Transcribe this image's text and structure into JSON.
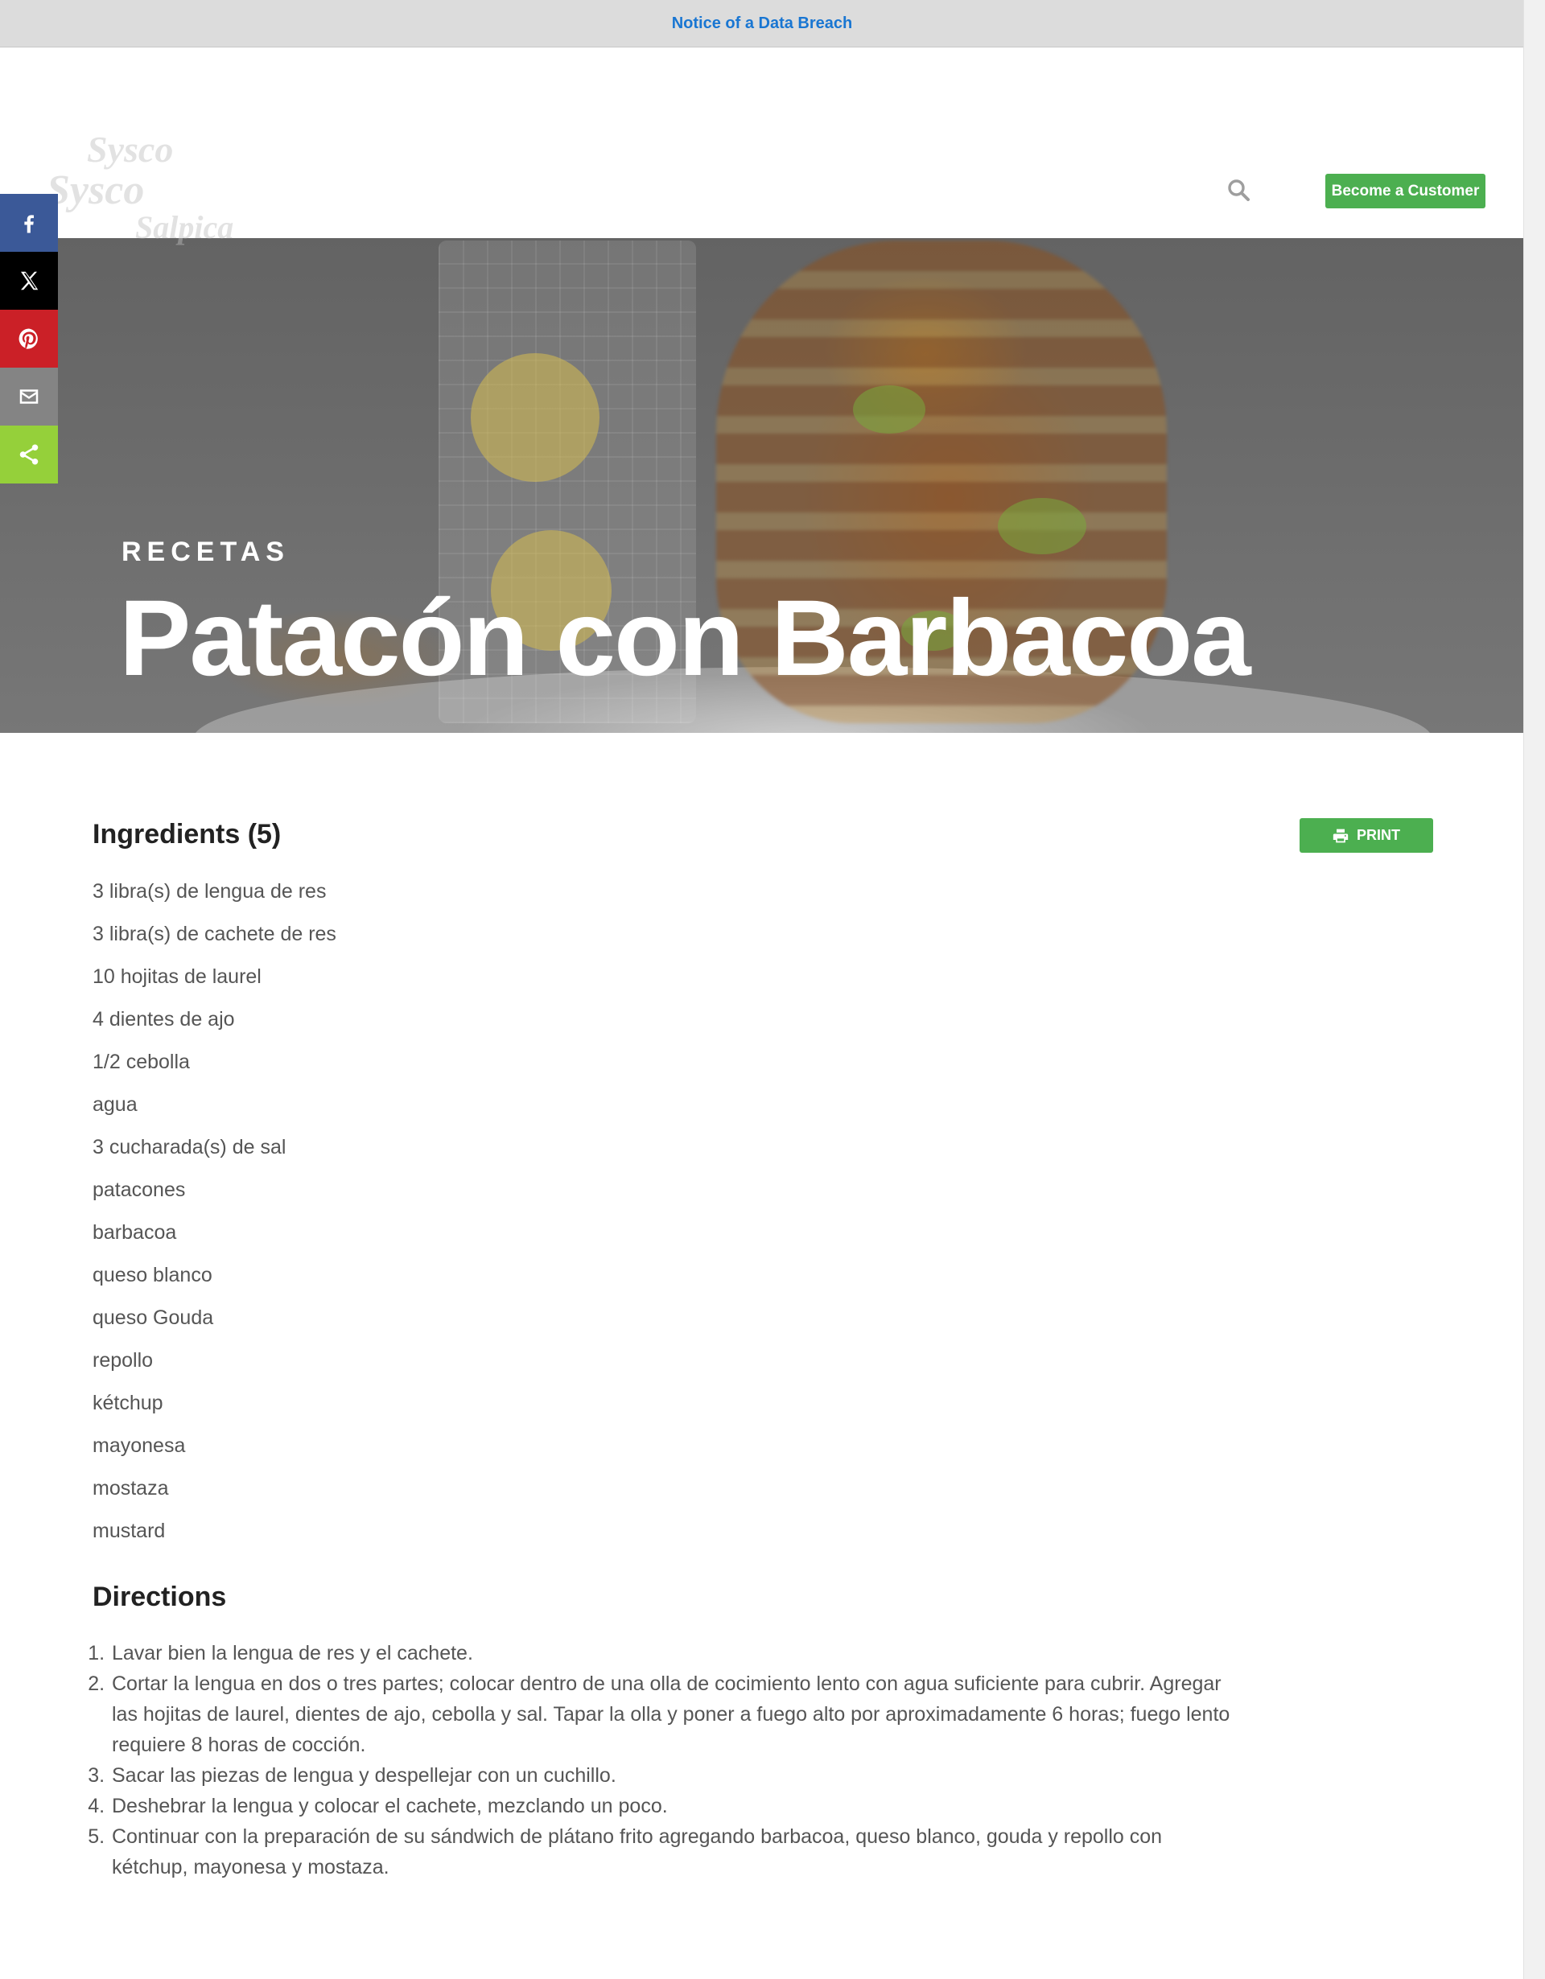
{
  "notice": {
    "link_text": "Notice of a Data Breach"
  },
  "header": {
    "logo_text": [
      "Sysco",
      "Sysco",
      "Salpica"
    ],
    "cta_label": "Become a Customer"
  },
  "share": {
    "items": [
      {
        "name": "facebook",
        "color": "#3b5998"
      },
      {
        "name": "x",
        "color": "#000000"
      },
      {
        "name": "pinterest",
        "color": "#cb2027"
      },
      {
        "name": "email",
        "color": "#848484"
      },
      {
        "name": "share",
        "color": "#95d03a"
      }
    ]
  },
  "hero": {
    "eyebrow": "RECETAS",
    "title": "Patacón con Barbacoa"
  },
  "ingredients": {
    "heading": "Ingredients (5)",
    "print_label": "PRINT",
    "items": [
      "3 libra(s) de lengua de res",
      "3 libra(s) de cachete de res",
      "10 hojitas de laurel",
      "4 dientes de ajo",
      "1/2 cebolla",
      "agua",
      "3 cucharada(s) de sal",
      "patacones",
      "barbacoa",
      "queso blanco",
      "queso Gouda",
      "repollo",
      "kétchup",
      "mayonesa",
      "mostaza",
      "mustard"
    ]
  },
  "directions": {
    "heading": "Directions",
    "steps": [
      "Lavar bien la lengua de res y el cachete.",
      "Cortar la lengua en dos o tres partes; colocar dentro de una olla de cocimiento lento con agua suficiente para cubrir. Agregar las hojitas de laurel, dientes de ajo, cebolla y sal. Tapar la olla y poner a fuego alto por aproximadamente 6 horas; fuego lento requiere 8 horas de cocción.",
      "Sacar las piezas de lengua y despellejar con un cuchillo.",
      "Deshebrar la lengua y colocar el cachete, mezclando un poco.",
      "Continuar con la preparación de su sándwich de plátano frito agregando barbacoa, queso blanco, gouda y repollo con kétchup, mayonesa y mostaza."
    ]
  },
  "colors": {
    "accent": "#4caf50",
    "link": "#1976d2"
  }
}
